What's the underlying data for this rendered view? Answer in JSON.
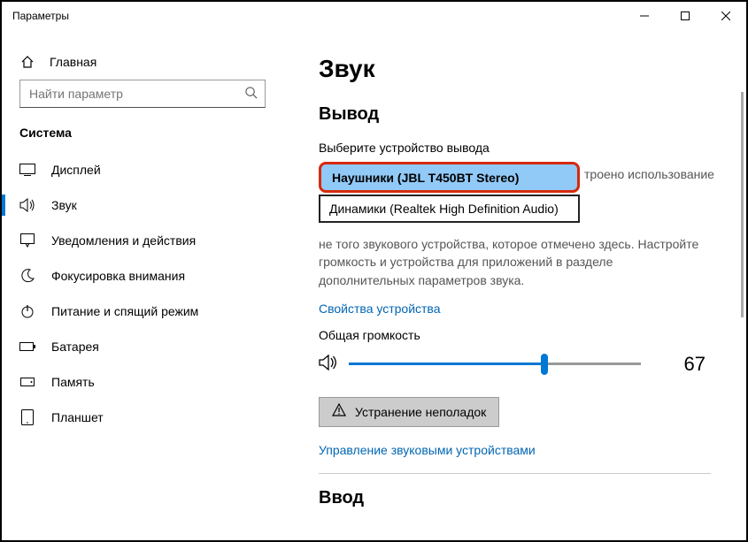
{
  "window": {
    "title": "Параметры"
  },
  "sidebar": {
    "home": "Главная",
    "search_placeholder": "Найти параметр",
    "section": "Система",
    "items": [
      {
        "label": "Дисплей"
      },
      {
        "label": "Звук"
      },
      {
        "label": "Уведомления и действия"
      },
      {
        "label": "Фокусировка внимания"
      },
      {
        "label": "Питание и спящий режим"
      },
      {
        "label": "Батарея"
      },
      {
        "label": "Память"
      },
      {
        "label": "Планшет"
      }
    ]
  },
  "main": {
    "title": "Звук",
    "output": {
      "heading": "Вывод",
      "select_label": "Выберите устройство вывода",
      "selected": "Наушники (JBL T450BT Stereo)",
      "option2": "Динамики (Realtek High Definition Audio)",
      "note_fragment": "троено использование",
      "note_rest": "не того звукового устройства, которое отмечено здесь. Настройте громкость и устройства для приложений в разделе дополнительных параметров звука.",
      "properties_link": "Свойства устройства",
      "volume_label": "Общая громкость",
      "volume_value": "67",
      "troubleshoot": "Устранение неполадок",
      "manage_link": "Управление звуковыми устройствами"
    },
    "input": {
      "heading": "Ввод"
    }
  }
}
